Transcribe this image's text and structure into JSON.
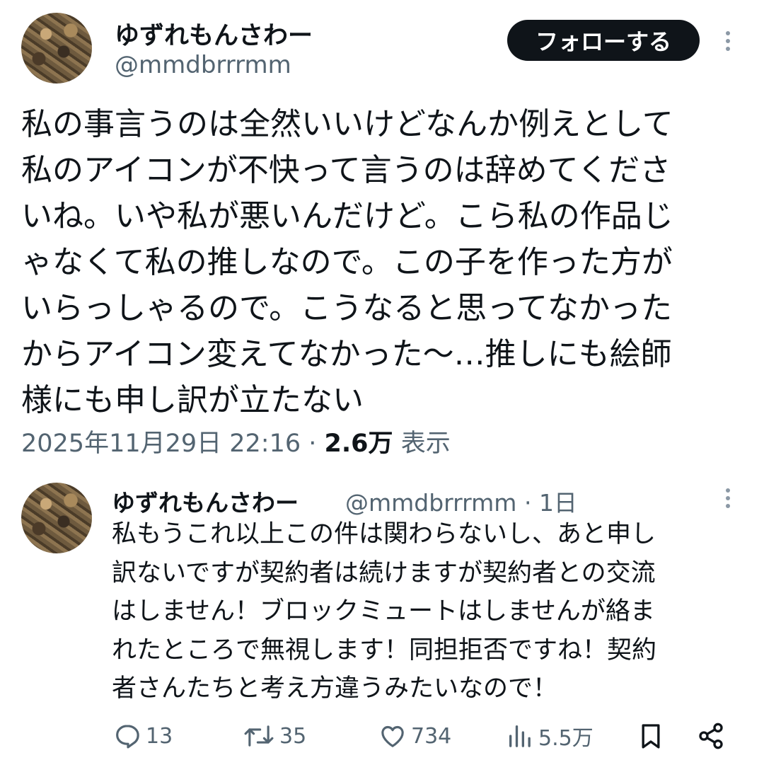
{
  "tweet": {
    "display_name": "ゆずれもんさわー",
    "handle": "@mmdbrrrmm",
    "follow_label": "フォローする",
    "text": "私の事言うのは全然いいけどなんか例えとして\n私のアイコンが不快って言うのは辞めてくださ\nいね。いや私が悪いんだけど。こら私の作品じ\nゃなくて私の推しなので。この子を作った方が\nいらっしゃるので。こうなると思ってなかった\nからアイコン変えてなかった〜…推しにも絵師\n様にも申し訳が立たない",
    "date": "2025年11月29日 22:16",
    "separator": " · ",
    "views_count": "2.6万",
    "views_label": "表示"
  },
  "reply": {
    "display_name": "ゆずれもんさわー",
    "handle": "@mmdbrrrmm",
    "separator": " · ",
    "time_ago": "1日",
    "text": "私もうこれ以上この件は関わらないし、あと申し\n訳ないですが契約者は続けますが契約者との交流\nはしません！ブロックミュートはしませんが絡ま\nれたところで無視します！同担拒否ですね！契約\n者さんたちと考え方違うみたいなので！",
    "actions": {
      "reply_count": "13",
      "retweet_count": "35",
      "like_count": "734",
      "views_count": "5.5万"
    }
  },
  "icons": {
    "more": "more-vertical-icon",
    "reply": "reply-icon",
    "retweet": "retweet-icon",
    "like": "heart-icon",
    "views": "views-icon",
    "bookmark": "bookmark-icon",
    "share": "share-icon"
  }
}
